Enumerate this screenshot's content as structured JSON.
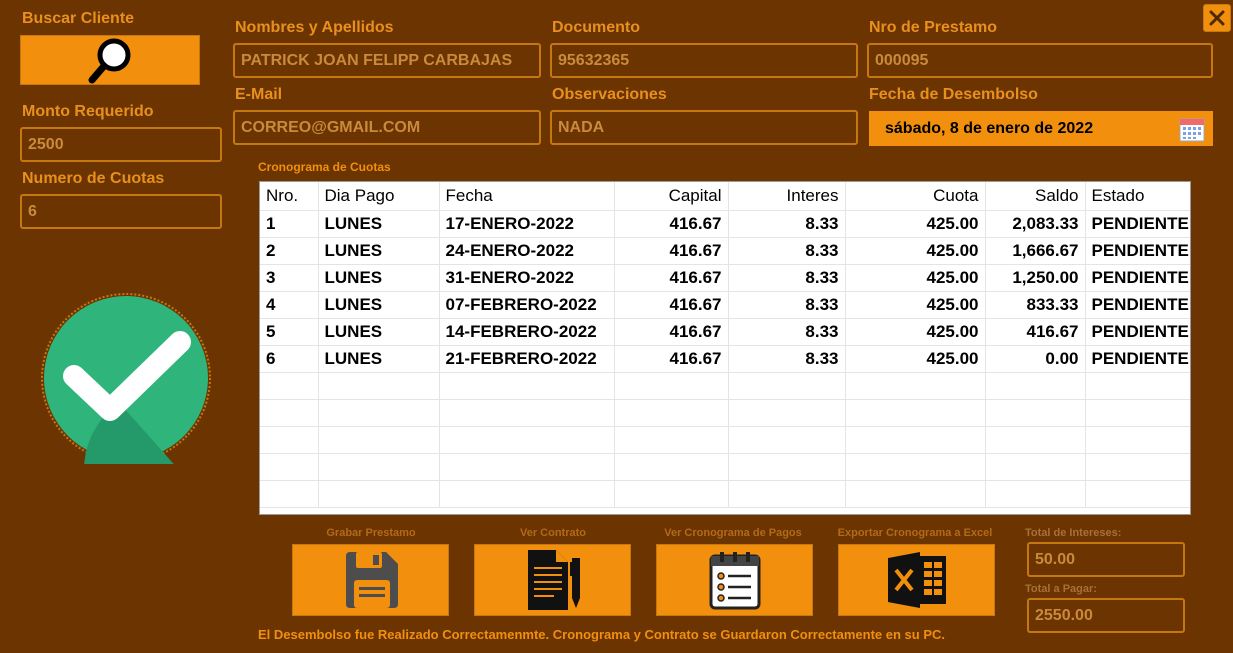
{
  "buscar_cliente": {
    "label": "Buscar Cliente"
  },
  "monto": {
    "label": "Monto Requerido",
    "value": "2500"
  },
  "cuotas": {
    "label": "Numero de Cuotas",
    "value": "6"
  },
  "nombres": {
    "label": "Nombres y Apellidos",
    "value": "PATRICK JOAN FELIPP CARBAJAS"
  },
  "documento": {
    "label": "Documento",
    "value": "95632365"
  },
  "nro_prestamo": {
    "label": "Nro de Prestamo",
    "value": "000095"
  },
  "email": {
    "label": "E-Mail",
    "value": "CORREO@GMAIL.COM"
  },
  "observaciones": {
    "label": "Observaciones",
    "value": "NADA"
  },
  "fecha_desembolso": {
    "label": "Fecha de Desembolso",
    "value": "sábado, 8 de enero de 2022"
  },
  "cronograma": {
    "title": "Cronograma de Cuotas",
    "headers": [
      "Nro.",
      "Dia Pago",
      "Fecha",
      "Capital",
      "Interes",
      "Cuota",
      "Saldo",
      "Estado"
    ],
    "rows": [
      [
        "1",
        "LUNES",
        "17-ENERO-2022",
        "416.67",
        "8.33",
        "425.00",
        "2,083.33",
        "PENDIENTE"
      ],
      [
        "2",
        "LUNES",
        "24-ENERO-2022",
        "416.67",
        "8.33",
        "425.00",
        "1,666.67",
        "PENDIENTE"
      ],
      [
        "3",
        "LUNES",
        "31-ENERO-2022",
        "416.67",
        "8.33",
        "425.00",
        "1,250.00",
        "PENDIENTE"
      ],
      [
        "4",
        "LUNES",
        "07-FEBRERO-2022",
        "416.67",
        "8.33",
        "425.00",
        "833.33",
        "PENDIENTE"
      ],
      [
        "5",
        "LUNES",
        "14-FEBRERO-2022",
        "416.67",
        "8.33",
        "425.00",
        "416.67",
        "PENDIENTE"
      ],
      [
        "6",
        "LUNES",
        "21-FEBRERO-2022",
        "416.67",
        "8.33",
        "425.00",
        "0.00",
        "PENDIENTE"
      ]
    ]
  },
  "actions": {
    "grabar": "Grabar Prestamo",
    "contrato": "Ver Contrato",
    "cronograma_pagos": "Ver Cronograma de Pagos",
    "exportar": "Exportar Cronograma a Excel"
  },
  "totales": {
    "intereses_label": "Total de Intereses:",
    "intereses_value": "50.00",
    "pagar_label": "Total a Pagar:",
    "pagar_value": "2550.00"
  },
  "status_message": "El Desembolso fue Realizado Correctamenmte. Cronograma y Contrato se Guardaron Correctamente en su PC.",
  "colors": {
    "background": "#6b3400",
    "accent": "#f28f0c",
    "label": "#e8901e",
    "success": "#2fb57c"
  }
}
